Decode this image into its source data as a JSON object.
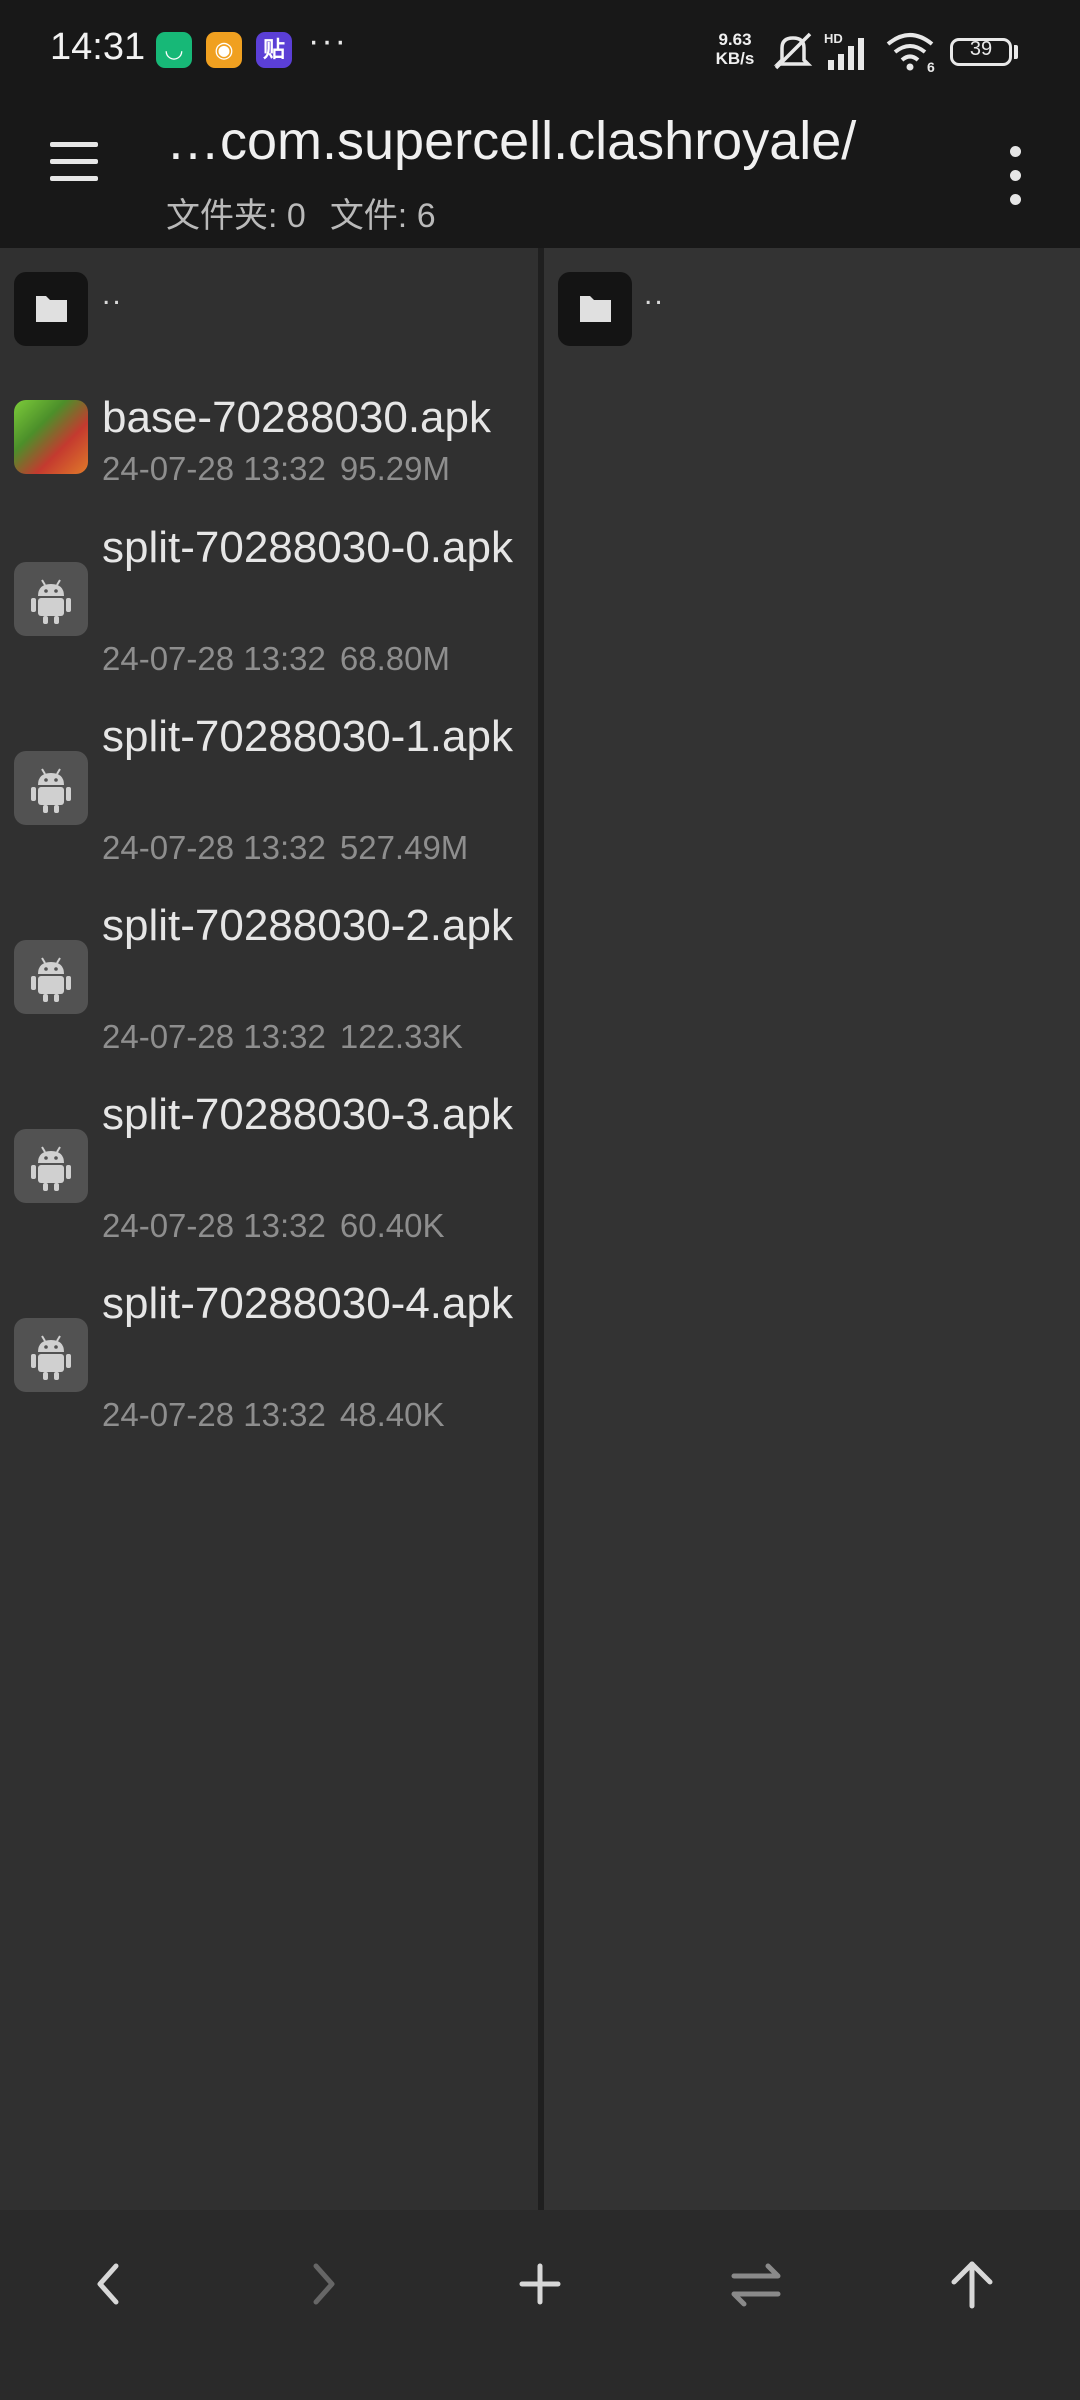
{
  "status_bar": {
    "time": "14:31",
    "notification_apps": [
      "mi-home-app",
      "weibo-app",
      "tieba-app"
    ],
    "more_dots": "···",
    "net_speed_value": "9.63",
    "net_speed_unit": "KB/s",
    "hd_label": "HD",
    "wifi_badge": "6",
    "battery": "39"
  },
  "toolbar": {
    "title": "…com.supercell.clashroyale/",
    "folders": "文件夹: 0",
    "files": "文件: 6"
  },
  "left_pane": {
    "parent": "..",
    "files": [
      {
        "name": "base-70288030.apk",
        "date": "24-07-28 13:32",
        "size": "95.29M",
        "icon": "game-app-icon"
      },
      {
        "name": "split-70288030-0.apk",
        "date": "24-07-28 13:32",
        "size": "68.80M",
        "icon": "android-icon"
      },
      {
        "name": "split-70288030-1.apk",
        "date": "24-07-28 13:32",
        "size": "527.49M",
        "icon": "android-icon"
      },
      {
        "name": "split-70288030-2.apk",
        "date": "24-07-28 13:32",
        "size": "122.33K",
        "icon": "android-icon"
      },
      {
        "name": "split-70288030-3.apk",
        "date": "24-07-28 13:32",
        "size": "60.40K",
        "icon": "android-icon"
      },
      {
        "name": "split-70288030-4.apk",
        "date": "24-07-28 13:32",
        "size": "48.40K",
        "icon": "android-icon"
      }
    ]
  },
  "right_pane": {
    "parent": ".."
  },
  "bottom_nav": {
    "icons": [
      "back-icon",
      "forward-icon",
      "add-icon",
      "swap-icon",
      "up-icon"
    ]
  }
}
